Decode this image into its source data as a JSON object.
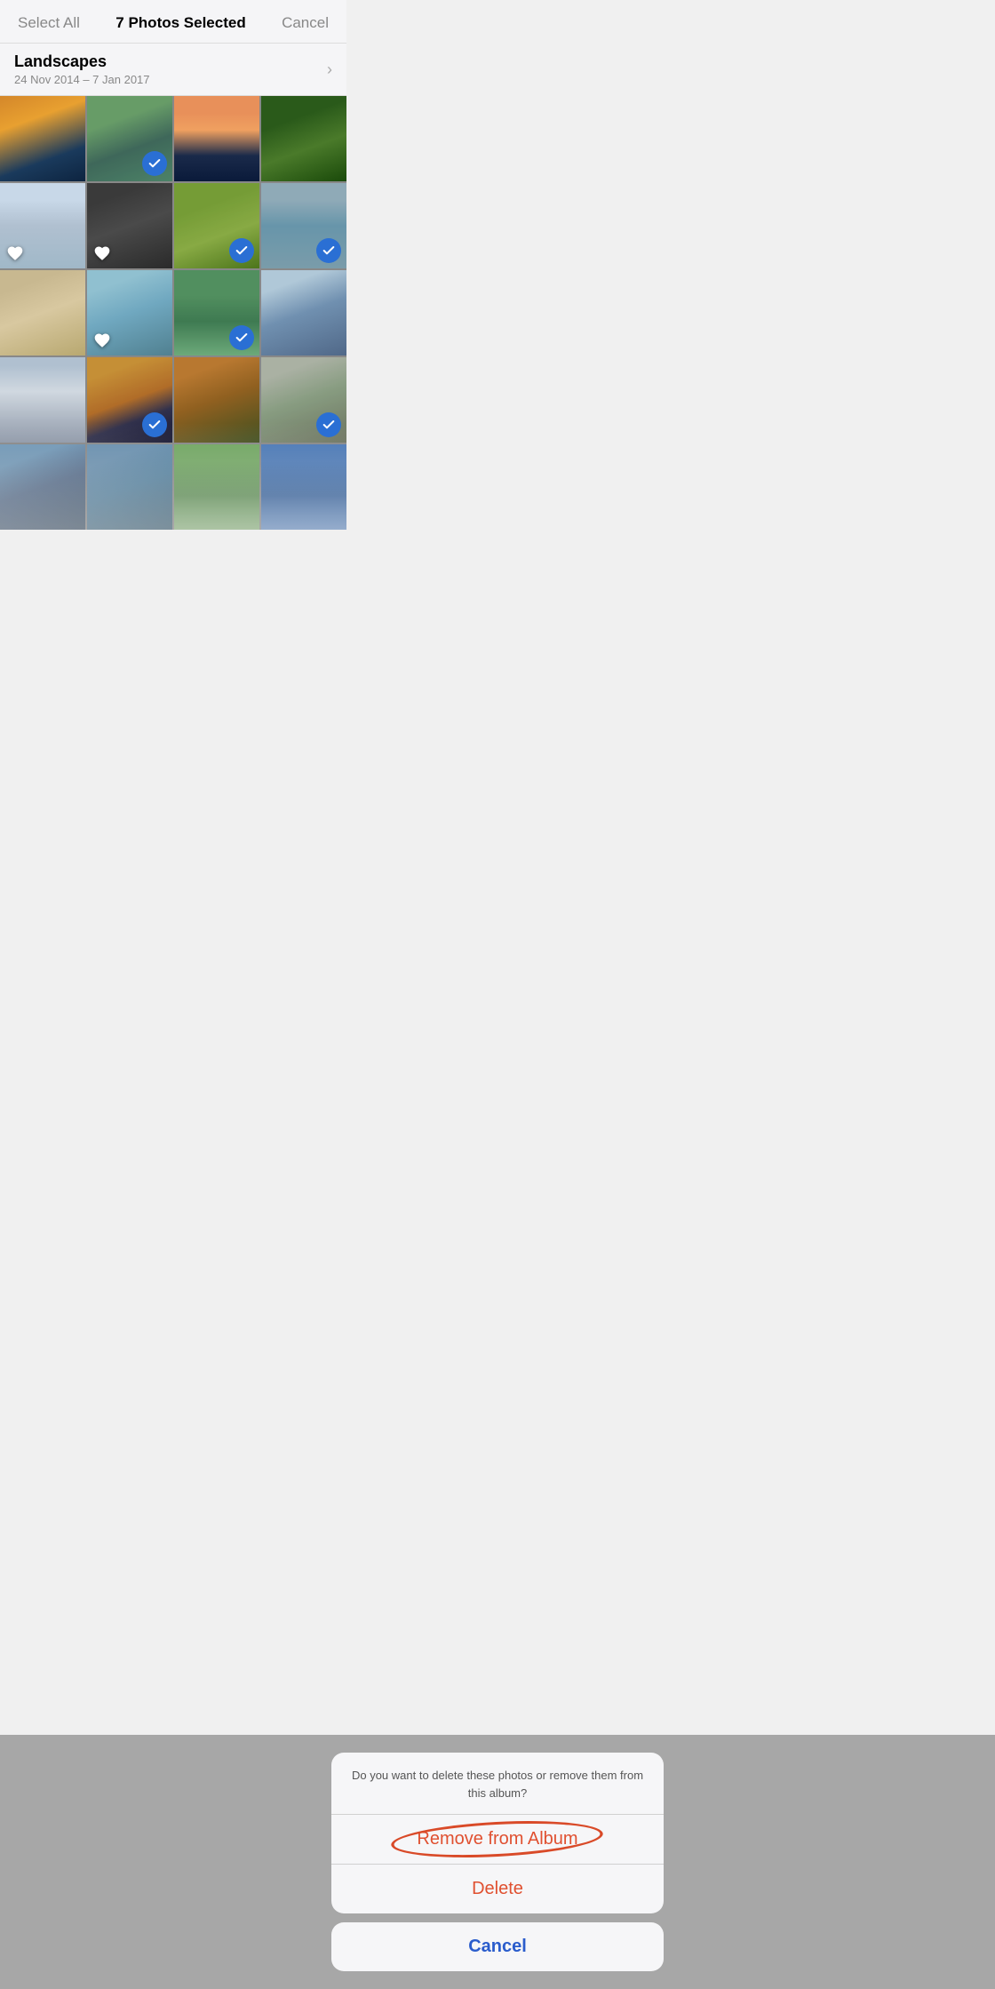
{
  "header": {
    "select_all": "Select All",
    "title": "7 Photos Selected",
    "cancel": "Cancel"
  },
  "album": {
    "name": "Landscapes",
    "date_range": "24 Nov 2014 – 7 Jan 2017"
  },
  "photos": [
    {
      "id": 1,
      "selected": false,
      "heart": false,
      "class": "photo-1"
    },
    {
      "id": 2,
      "selected": true,
      "heart": false,
      "class": "photo-2"
    },
    {
      "id": 3,
      "selected": false,
      "heart": false,
      "class": "photo-3"
    },
    {
      "id": 4,
      "selected": false,
      "heart": false,
      "class": "photo-4"
    },
    {
      "id": 5,
      "selected": false,
      "heart": true,
      "class": "photo-5"
    },
    {
      "id": 6,
      "selected": false,
      "heart": true,
      "class": "photo-6"
    },
    {
      "id": 7,
      "selected": true,
      "heart": false,
      "class": "photo-7"
    },
    {
      "id": 8,
      "selected": true,
      "heart": false,
      "class": "photo-8"
    },
    {
      "id": 9,
      "selected": false,
      "heart": false,
      "class": "photo-9"
    },
    {
      "id": 10,
      "selected": false,
      "heart": true,
      "class": "photo-10"
    },
    {
      "id": 11,
      "selected": true,
      "heart": false,
      "class": "photo-11"
    },
    {
      "id": 12,
      "selected": false,
      "heart": false,
      "class": "photo-12"
    },
    {
      "id": 13,
      "selected": false,
      "heart": false,
      "class": "photo-13"
    },
    {
      "id": 14,
      "selected": true,
      "heart": false,
      "class": "photo-14"
    },
    {
      "id": 15,
      "selected": false,
      "heart": false,
      "class": "photo-15"
    },
    {
      "id": 16,
      "selected": true,
      "heart": false,
      "class": "photo-16"
    },
    {
      "id": 17,
      "selected": false,
      "heart": false,
      "class": "photo-17"
    },
    {
      "id": 18,
      "selected": false,
      "heart": false,
      "class": "photo-18"
    },
    {
      "id": 19,
      "selected": false,
      "heart": false,
      "class": "photo-19"
    },
    {
      "id": 20,
      "selected": false,
      "heart": false,
      "class": "photo-20"
    }
  ],
  "action_sheet": {
    "message": "Do you want to delete these photos or remove them from this album?",
    "remove_label": "Remove from Album",
    "delete_label": "Delete",
    "cancel_label": "Cancel"
  }
}
